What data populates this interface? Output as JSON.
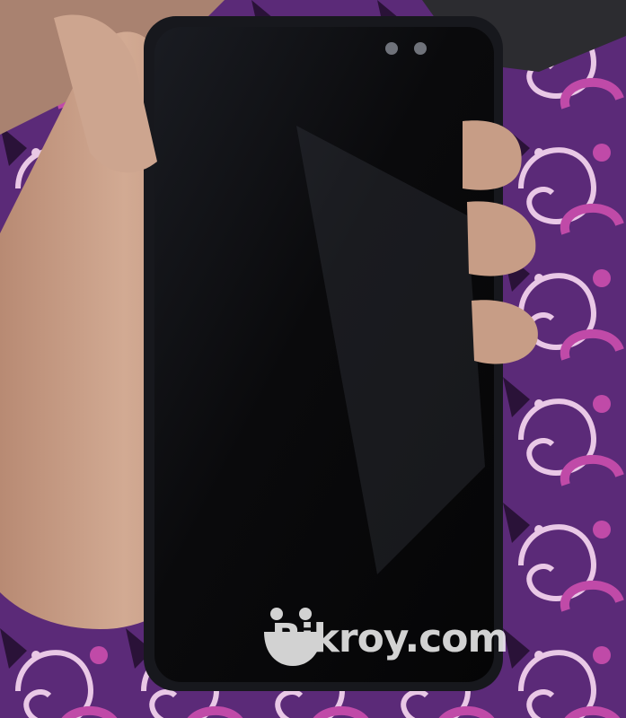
{
  "photo": {
    "subject": "hand-holding-phone",
    "colors": {
      "fabric_base": "#5b2a78",
      "fabric_pattern": "#c04aa8",
      "fabric_light": "#e9c8e6",
      "skin": "#c9a089",
      "phone_body": "#0b0b0e"
    }
  },
  "watermark": {
    "icon": "smiley-face-icon",
    "text": "Bikroy.com"
  }
}
